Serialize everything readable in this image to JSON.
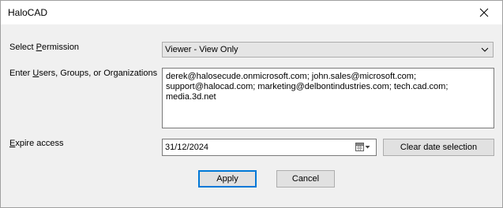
{
  "window": {
    "title": "HaloCAD"
  },
  "icons": {
    "close": "close-icon",
    "dropdown": "chevron-down-icon",
    "calendar": "calendar-icon"
  },
  "permission": {
    "label_pre": "Select ",
    "label_u": "P",
    "label_post": "ermission",
    "value": "Viewer - View Only"
  },
  "users": {
    "label_pre": "Enter ",
    "label_u": "U",
    "label_post": "sers, Groups, or Organizations",
    "value": "derek@halosecude.onmicrosoft.com; john.sales@microsoft.com; support@halocad.com; marketing@delbontindustries.com; tech.cad.com; media.3d.net"
  },
  "expire": {
    "label_u": "E",
    "label_post": "xpire access",
    "date": "31/12/2024",
    "clear_label": "Clear date selection"
  },
  "actions": {
    "apply": "Apply",
    "cancel": "Cancel"
  },
  "colors": {
    "focus": "#0078d7",
    "button": "#e1e1e1",
    "dropdown": "#e5e5e5"
  }
}
